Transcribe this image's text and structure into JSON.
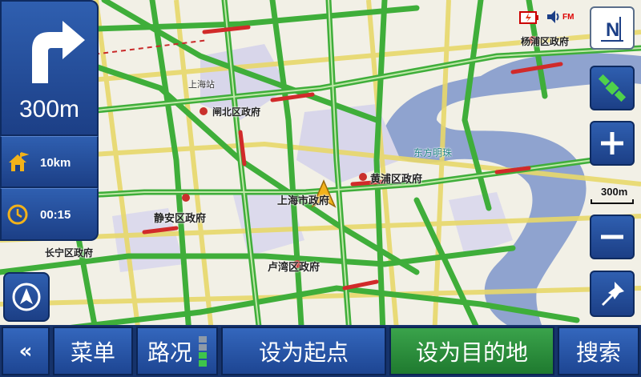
{
  "navigation": {
    "turn_distance": "300m",
    "remaining_distance": "10km",
    "remaining_time": "00:15"
  },
  "status": {
    "radio": "FM"
  },
  "map_labels": {
    "yangpu": "杨浦区政府",
    "zhabei": "闸北区政府",
    "huangpu": "黄浦区政府",
    "shanghai_gov": "上海市政府",
    "jingan": "静安区政府",
    "changning": "长宁区政府",
    "luwan": "卢湾区政府",
    "shanghai_station": "上海站",
    "oriental_pearl": "东方明珠"
  },
  "scale": "300m",
  "bottom_bar": {
    "back": "«",
    "menu": "菜单",
    "traffic": "路况",
    "set_start": "设为起点",
    "set_destination": "设为目的地",
    "search": "搜索"
  },
  "colors": {
    "panel_blue": "#2f5fb0",
    "road_green": "#3fae3a",
    "river": "#8fa3cf",
    "active_button": "#3aa34b"
  }
}
